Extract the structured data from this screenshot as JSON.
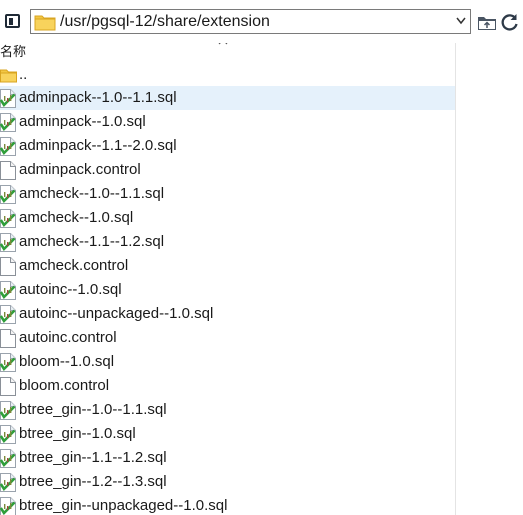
{
  "address_bar": {
    "path": "/usr/pgsql-12/share/extension"
  },
  "file_list": {
    "column_header": "名称",
    "parent_dir": "..",
    "files": [
      {
        "name": "adminpack--1.0--1.1.sql",
        "type": "sql",
        "selected": true
      },
      {
        "name": "adminpack--1.0.sql",
        "type": "sql"
      },
      {
        "name": "adminpack--1.1--2.0.sql",
        "type": "sql"
      },
      {
        "name": "adminpack.control",
        "type": "file"
      },
      {
        "name": "amcheck--1.0--1.1.sql",
        "type": "sql"
      },
      {
        "name": "amcheck--1.0.sql",
        "type": "sql"
      },
      {
        "name": "amcheck--1.1--1.2.sql",
        "type": "sql"
      },
      {
        "name": "amcheck.control",
        "type": "file"
      },
      {
        "name": "autoinc--1.0.sql",
        "type": "sql"
      },
      {
        "name": "autoinc--unpackaged--1.0.sql",
        "type": "sql"
      },
      {
        "name": "autoinc.control",
        "type": "file"
      },
      {
        "name": "bloom--1.0.sql",
        "type": "sql"
      },
      {
        "name": "bloom.control",
        "type": "file"
      },
      {
        "name": "btree_gin--1.0--1.1.sql",
        "type": "sql"
      },
      {
        "name": "btree_gin--1.0.sql",
        "type": "sql"
      },
      {
        "name": "btree_gin--1.1--1.2.sql",
        "type": "sql"
      },
      {
        "name": "btree_gin--1.2--1.3.sql",
        "type": "sql"
      },
      {
        "name": "btree_gin--unpackaged--1.0.sql",
        "type": "sql"
      }
    ]
  },
  "colors": {
    "selection": "#e5f1fb",
    "folder": "#f2c744"
  }
}
